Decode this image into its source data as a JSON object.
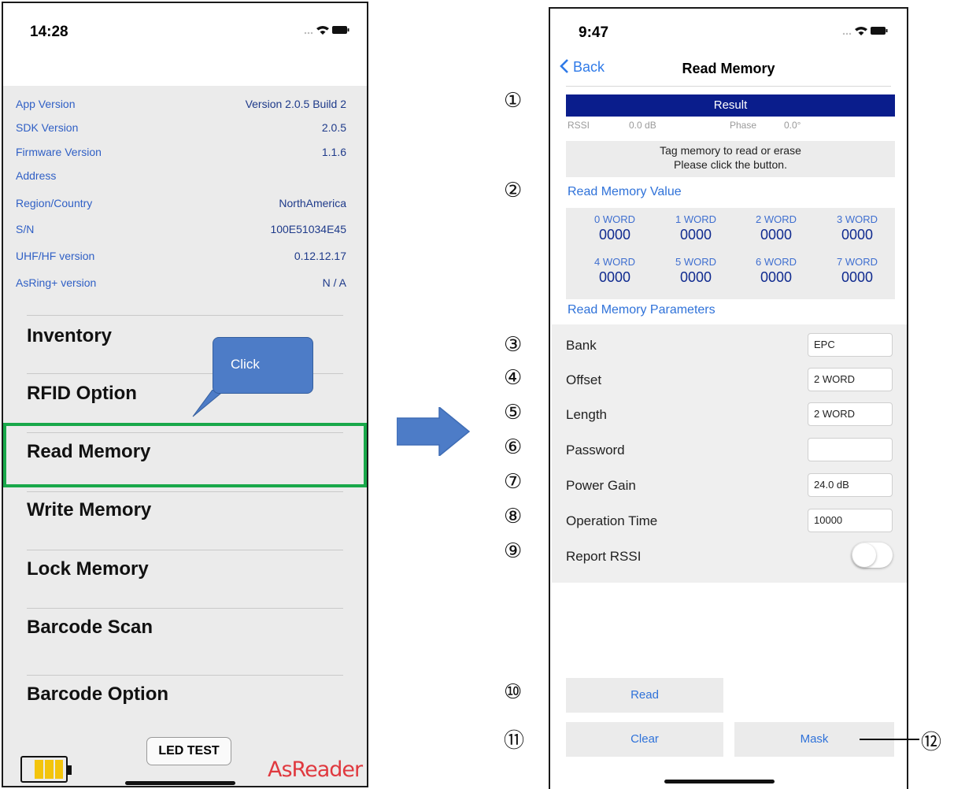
{
  "left_phone": {
    "status_time": "14:28",
    "info_rows": [
      {
        "label": "App Version",
        "value": "Version 2.0.5 Build 2"
      },
      {
        "label": "SDK Version",
        "value": "2.0.5"
      },
      {
        "label": "Firmware Version",
        "value": "1.1.6"
      },
      {
        "label": "Address",
        "value": ""
      },
      {
        "label": "Region/Country",
        "value": "NorthAmerica"
      },
      {
        "label": "S/N",
        "value": "100E51034E45"
      },
      {
        "label": "UHF/HF version",
        "value": "0.12.12.17"
      },
      {
        "label": "AsRing+ version",
        "value": "N / A"
      }
    ],
    "menu": [
      "Inventory",
      "RFID Option",
      "Read Memory",
      "Write Memory",
      "Lock Memory",
      "Barcode Scan",
      "Barcode Option"
    ],
    "callout": "Click",
    "led_button": "LED TEST",
    "brand": "AsReader"
  },
  "right_phone": {
    "status_time": "9:47",
    "back_label": "Back",
    "title": "Read Memory",
    "result_label": "Result",
    "rssi_label": "RSSI",
    "rssi_value": "0.0 dB",
    "phase_label": "Phase",
    "phase_value": "0.0°",
    "message_line1": "Tag memory to read or erase",
    "message_line2": "Please click the button.",
    "value_section": "Read Memory Value",
    "words": [
      {
        "label": "0 WORD",
        "value": "0000"
      },
      {
        "label": "1 WORD",
        "value": "0000"
      },
      {
        "label": "2 WORD",
        "value": "0000"
      },
      {
        "label": "3 WORD",
        "value": "0000"
      },
      {
        "label": "4 WORD",
        "value": "0000"
      },
      {
        "label": "5 WORD",
        "value": "0000"
      },
      {
        "label": "6 WORD",
        "value": "0000"
      },
      {
        "label": "7 WORD",
        "value": "0000"
      }
    ],
    "params_section": "Read Memory Parameters",
    "params": [
      {
        "label": "Bank",
        "value": "EPC"
      },
      {
        "label": "Offset",
        "value": "2 WORD"
      },
      {
        "label": "Length",
        "value": "2 WORD"
      },
      {
        "label": "Password",
        "value": ""
      },
      {
        "label": "Power Gain",
        "value": "24.0 dB"
      },
      {
        "label": "Operation Time",
        "value": "10000"
      }
    ],
    "report_rssi_label": "Report RSSI",
    "report_rssi_on": false,
    "read_button": "Read",
    "clear_button": "Clear",
    "mask_button": "Mask"
  },
  "annotations": {
    "markers": [
      "①",
      "②",
      "③",
      "④",
      "⑤",
      "⑥",
      "⑦",
      "⑧",
      "⑨",
      "⑩",
      "⑪",
      "⑫"
    ]
  }
}
